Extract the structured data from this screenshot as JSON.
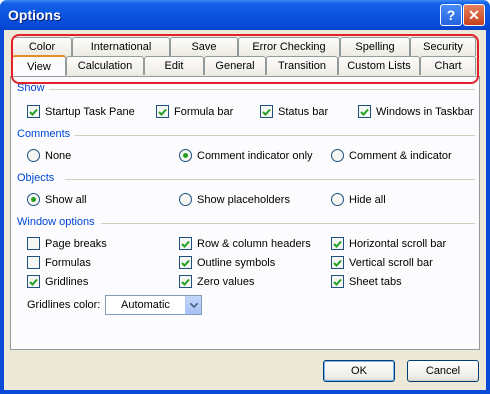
{
  "window": {
    "title": "Options"
  },
  "title_buttons": {
    "help": "?",
    "close": "✕"
  },
  "tabs": {
    "row1": [
      "Color",
      "International",
      "Save",
      "Error Checking",
      "Spelling",
      "Security"
    ],
    "row2": [
      "View",
      "Calculation",
      "Edit",
      "General",
      "Transition",
      "Custom Lists",
      "Chart"
    ],
    "active": "View"
  },
  "show": {
    "title": "Show",
    "items": [
      {
        "label": "Startup Task Pane",
        "checked": true
      },
      {
        "label": "Formula bar",
        "checked": true
      },
      {
        "label": "Status bar",
        "checked": true
      },
      {
        "label": "Windows in Taskbar",
        "checked": true
      }
    ]
  },
  "comments": {
    "title": "Comments",
    "items": [
      {
        "label": "None",
        "selected": false
      },
      {
        "label": "Comment indicator only",
        "selected": true
      },
      {
        "label": "Comment & indicator",
        "selected": false
      }
    ]
  },
  "objects": {
    "title": "Objects",
    "items": [
      {
        "label": "Show all",
        "selected": true
      },
      {
        "label": "Show placeholders",
        "selected": false
      },
      {
        "label": "Hide all",
        "selected": false
      }
    ]
  },
  "window_options": {
    "title": "Window options",
    "col1": [
      {
        "label": "Page breaks",
        "checked": false
      },
      {
        "label": "Formulas",
        "checked": false
      },
      {
        "label": "Gridlines",
        "checked": true
      }
    ],
    "col2": [
      {
        "label": "Row & column headers",
        "checked": true
      },
      {
        "label": "Outline symbols",
        "checked": true
      },
      {
        "label": "Zero values",
        "checked": true
      }
    ],
    "col3": [
      {
        "label": "Horizontal scroll bar",
        "checked": true
      },
      {
        "label": "Vertical scroll bar",
        "checked": true
      },
      {
        "label": "Sheet tabs",
        "checked": true
      }
    ],
    "gridlines_color_label": "Gridlines color:",
    "gridlines_color_value": "Automatic"
  },
  "buttons": {
    "ok": "OK",
    "cancel": "Cancel"
  },
  "colors": {
    "highlight_outline": "#e3202a",
    "section_title": "#0046d5",
    "check_green": "#21a121"
  }
}
